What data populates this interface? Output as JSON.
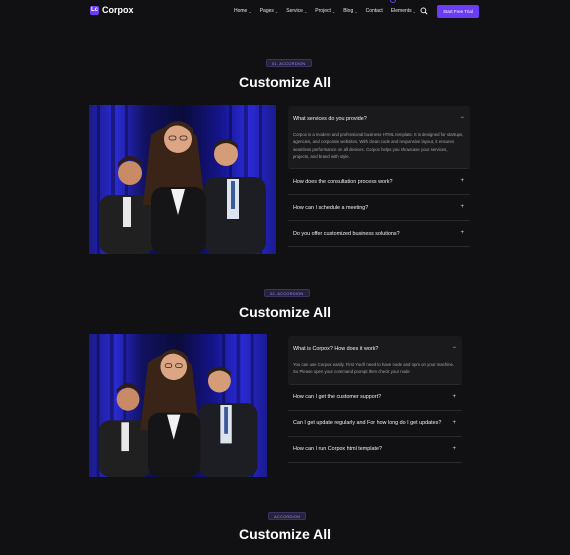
{
  "header": {
    "logo_mark": "Lc",
    "logo_text": "Corpox",
    "nav": [
      "Home",
      "Pages",
      "Service",
      "Project",
      "Blog",
      "Contact",
      "Elements"
    ],
    "nav_has_dropdown": [
      true,
      true,
      true,
      true,
      true,
      false,
      true
    ],
    "cta_label": "Start Free Trial"
  },
  "sections": [
    {
      "badge": "01. ACCORDION",
      "title": "Customize All",
      "items": [
        {
          "q": "What services do you provide?",
          "open": true,
          "a": "Corpox is a modern and professional business HTML template. It is designed for startups, agencies, and corporate websites. With clean code and responsive layout, it ensures seamless performance on all devices. Corpox helps you showcase your services, projects, and brand with style."
        },
        {
          "q": "How does the consultation process work?",
          "open": false
        },
        {
          "q": "How can I schedule a meeting?",
          "open": false
        },
        {
          "q": "Do you offer customized business solutions?",
          "open": false
        }
      ]
    },
    {
      "badge": "02. ACCORDION",
      "title": "Customize All",
      "items": [
        {
          "q": "What is Corpox? How does it work?",
          "open": true,
          "a": "You can use Corpox easily. First You'll need to have node and npm on your machine. So Please open your command prompt then check your node"
        },
        {
          "q": "How can I get the customer support?",
          "open": false
        },
        {
          "q": "Can I get update regularly and For how long do I get updates?",
          "open": false
        },
        {
          "q": "How can I run Corpox html template?",
          "open": false
        }
      ]
    },
    {
      "badge": "ACCORDION",
      "title": "Customize All"
    }
  ],
  "colors": {
    "accent": "#6b3cf5",
    "bg": "#111113"
  }
}
